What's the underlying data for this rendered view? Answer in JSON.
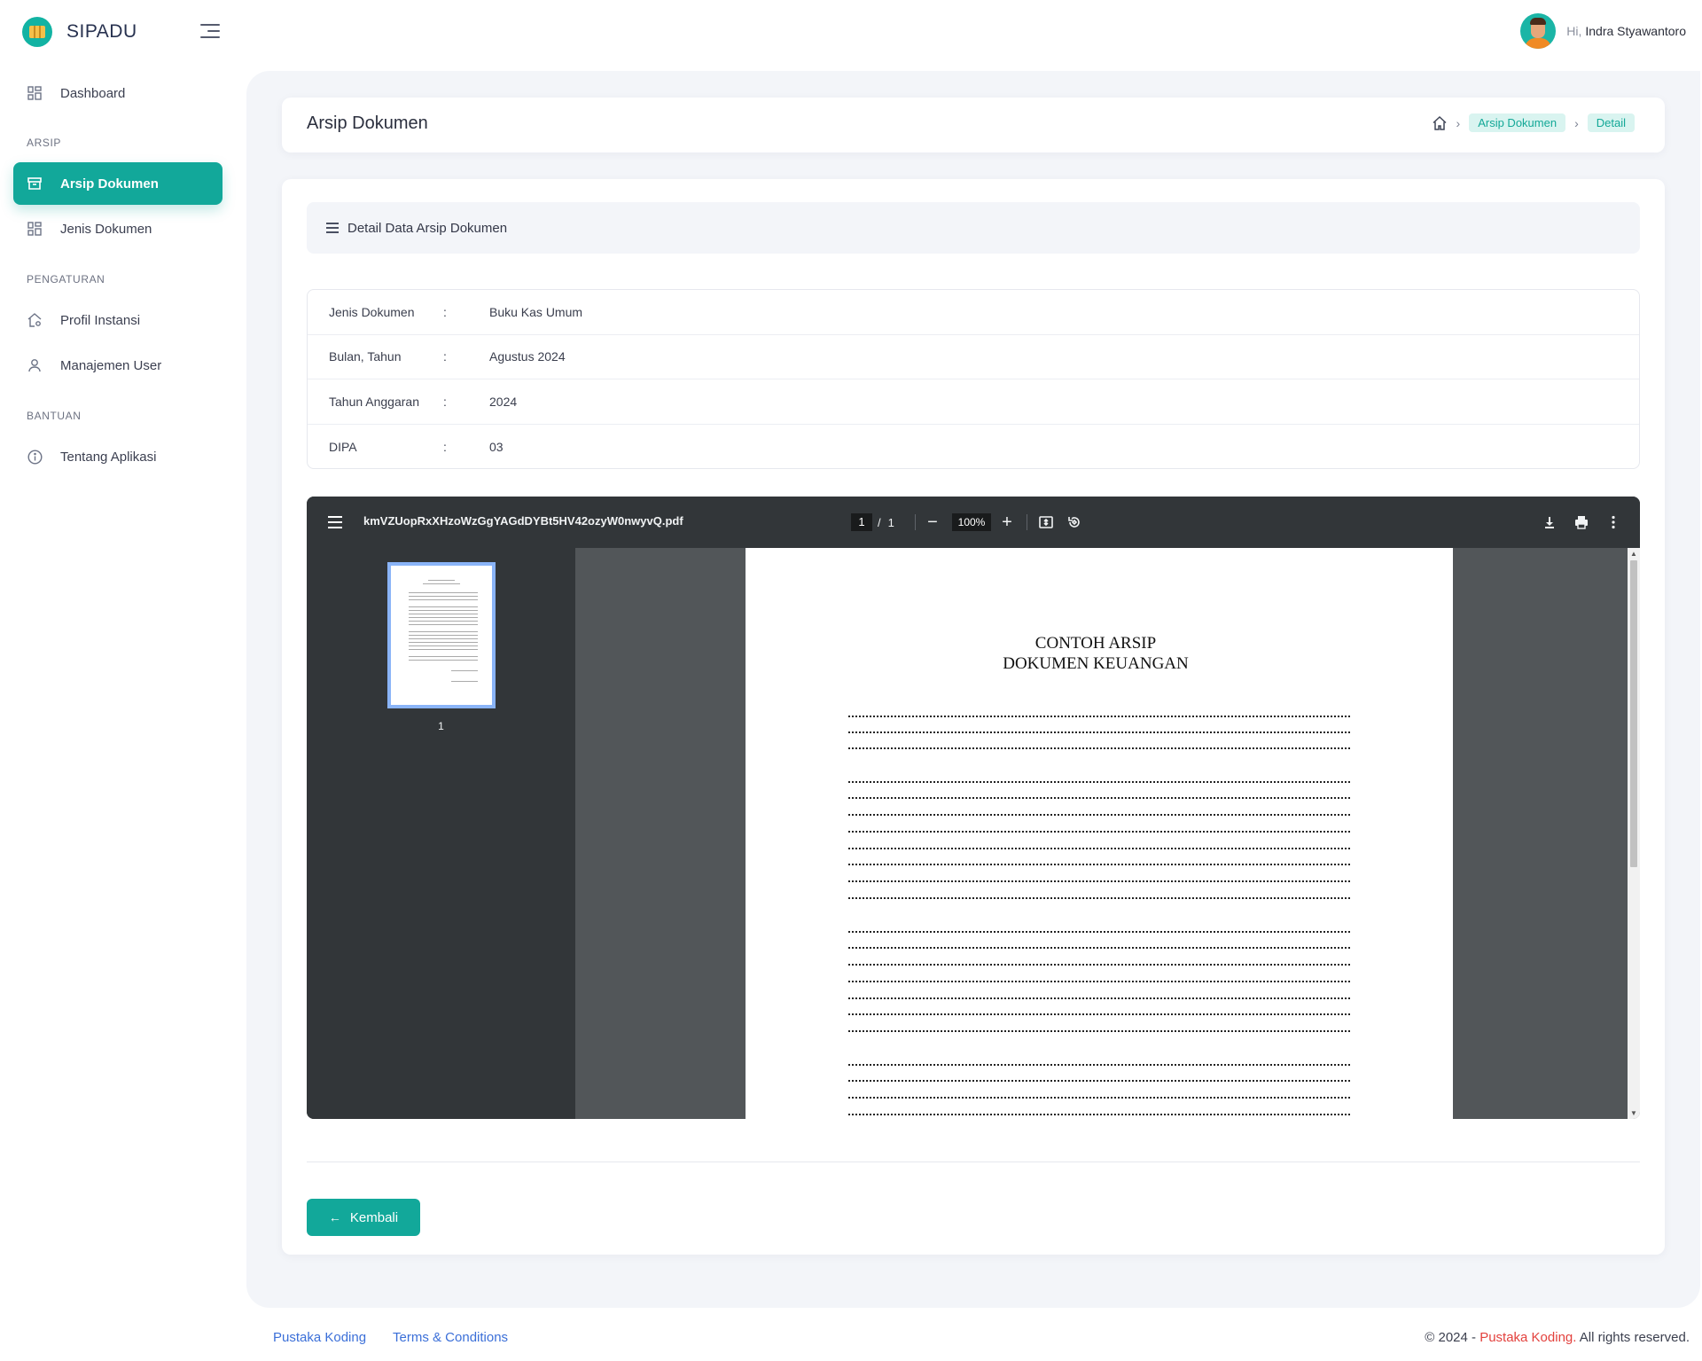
{
  "app": {
    "name": "SIPADU"
  },
  "user": {
    "greeting": "Hi,",
    "name": "Indra Styawantoro"
  },
  "sidebar": {
    "dashboard": "Dashboard",
    "sections": {
      "arsip": "ARSIP",
      "pengaturan": "PENGATURAN",
      "bantuan": "BANTUAN"
    },
    "items": {
      "arsip_dokumen": "Arsip Dokumen",
      "jenis_dokumen": "Jenis Dokumen",
      "profil_instansi": "Profil Instansi",
      "manajemen_user": "Manajemen User",
      "tentang_aplikasi": "Tentang Aplikasi"
    },
    "active": "Arsip Dokumen"
  },
  "header": {
    "title": "Arsip Dokumen",
    "breadcrumb": [
      "Arsip Dokumen",
      "Detail"
    ]
  },
  "card": {
    "title": "Detail Data Arsip Dokumen",
    "rows": [
      {
        "label": "Jenis Dokumen",
        "sep": ":",
        "value": "Buku Kas Umum"
      },
      {
        "label": "Bulan, Tahun",
        "sep": ":",
        "value": "Agustus 2024"
      },
      {
        "label": "Tahun Anggaran",
        "sep": ":",
        "value": "2024"
      },
      {
        "label": "DIPA",
        "sep": ":",
        "value": "03"
      }
    ],
    "back_label": "Kembali"
  },
  "pdf": {
    "filename": "kmVZUopRxXHzoWzGgYAGdDYBt5HV42ozyW0nwyvQ.pdf",
    "current_page": "1",
    "page_sep": "/",
    "total_pages": "1",
    "zoom": "100%",
    "thumb_label": "1",
    "doc_title_line1": "CONTOH ARSIP",
    "doc_title_line2": "DOKUMEN KEUANGAN"
  },
  "footer": {
    "links": [
      "Pustaka Koding",
      "Terms & Conditions"
    ],
    "copyright_prefix": "© 2024 - ",
    "copyright_brand": "Pustaka Koding.",
    "copyright_suffix": " All rights reserved."
  },
  "colors": {
    "accent": "#12a89a",
    "accent_light": "#d9f4f0",
    "footer_link": "#3b6fd8",
    "brand_red": "#e3413d"
  }
}
